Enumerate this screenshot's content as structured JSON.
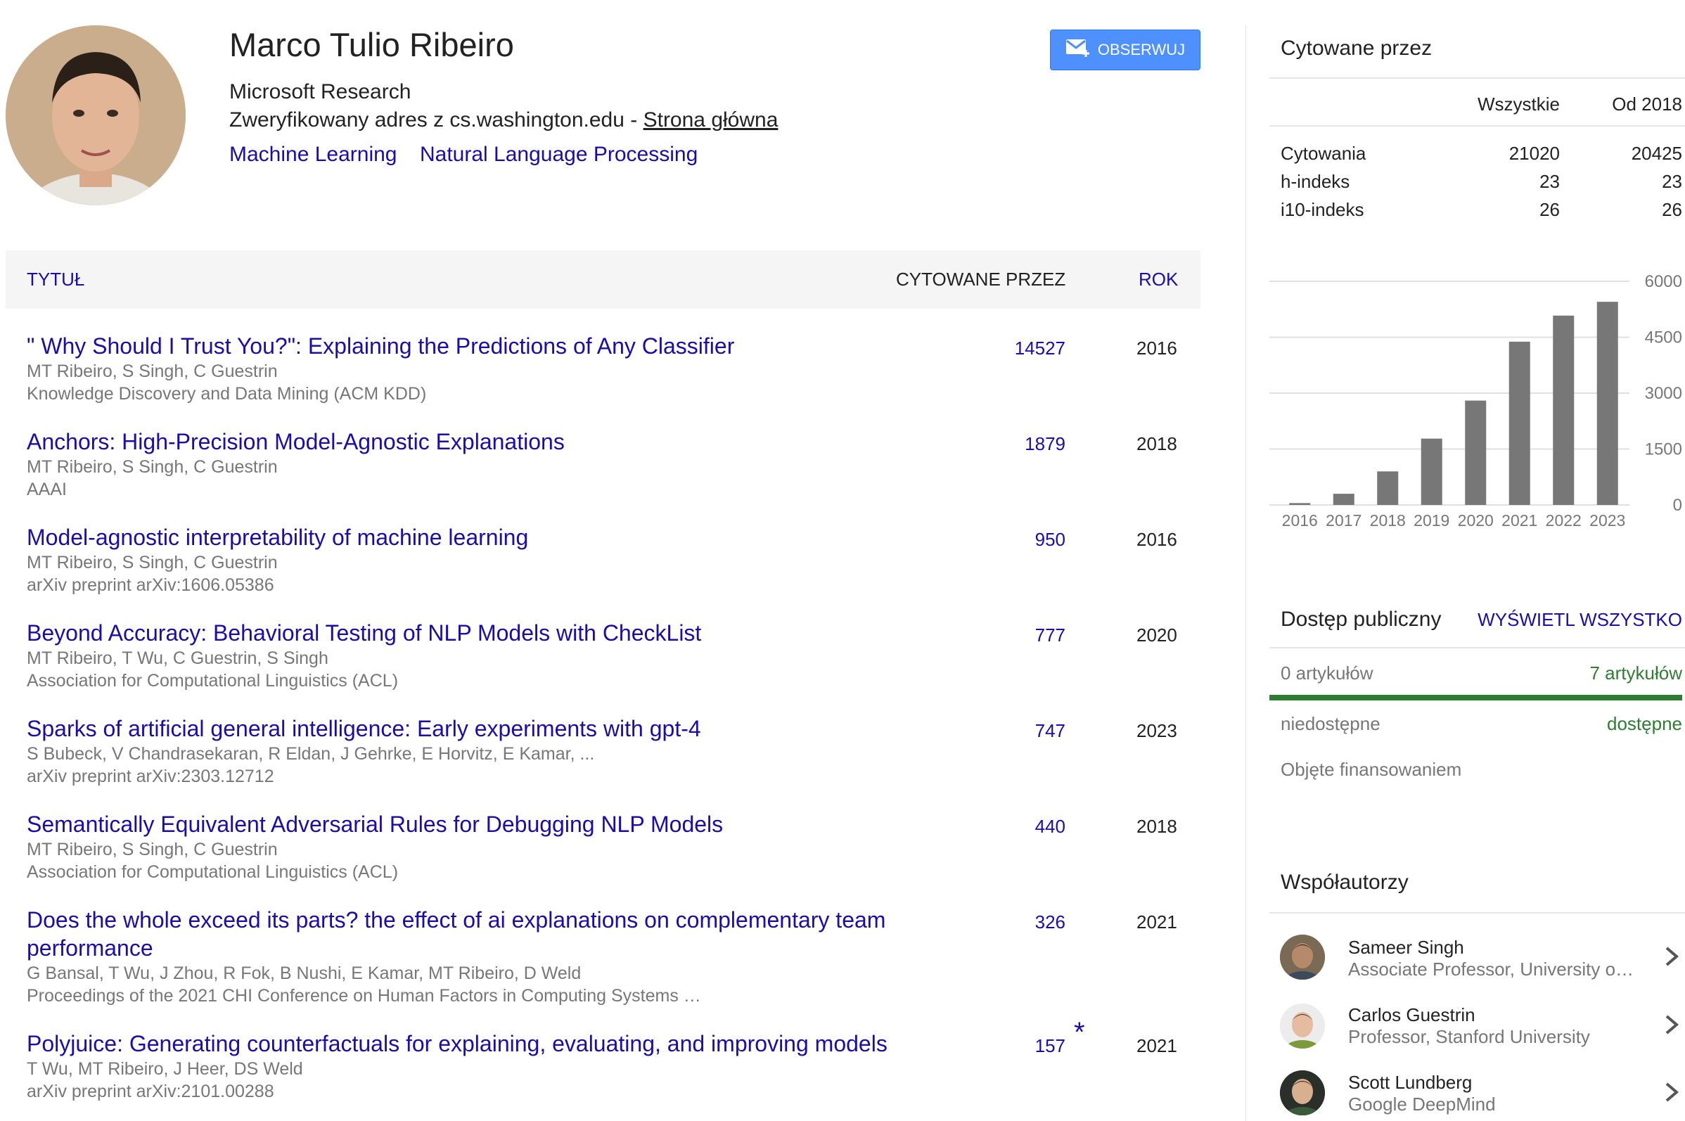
{
  "profile": {
    "name": "Marco Tulio Ribeiro",
    "affiliation": "Microsoft Research",
    "verified_text": "Zweryfikowany adres z cs.washington.edu - ",
    "home_link": "Strona główna",
    "interests": [
      "Machine Learning",
      "Natural Language Processing"
    ],
    "follow_label": "OBSERWUJ"
  },
  "table": {
    "col_title": "TYTUŁ",
    "col_cited": "CYTOWANE PRZEZ",
    "col_year": "ROK",
    "articles": [
      {
        "title": "\" Why Should I Trust You?\": Explaining the Predictions of Any Classifier",
        "authors": "MT Ribeiro, S Singh, C Guestrin",
        "venue": "Knowledge Discovery and Data Mining (ACM KDD)",
        "cites": "14527",
        "year": "2016"
      },
      {
        "title": "Anchors: High-Precision Model-Agnostic Explanations",
        "authors": "MT Ribeiro, S Singh, C Guestrin",
        "venue": "AAAI",
        "cites": "1879",
        "year": "2018"
      },
      {
        "title": "Model-agnostic interpretability of machine learning",
        "authors": "MT Ribeiro, S Singh, C Guestrin",
        "venue": "arXiv preprint arXiv:1606.05386",
        "cites": "950",
        "year": "2016"
      },
      {
        "title": "Beyond Accuracy: Behavioral Testing of NLP Models with CheckList",
        "authors": "MT Ribeiro, T Wu, C Guestrin, S Singh",
        "venue": "Association for Computational Linguistics (ACL)",
        "cites": "777",
        "year": "2020"
      },
      {
        "title": "Sparks of artificial general intelligence: Early experiments with gpt-4",
        "authors": "S Bubeck, V Chandrasekaran, R Eldan, J Gehrke, E Horvitz, E Kamar, ...",
        "venue": "arXiv preprint arXiv:2303.12712",
        "cites": "747",
        "year": "2023"
      },
      {
        "title": "Semantically Equivalent Adversarial Rules for Debugging NLP Models",
        "authors": "MT Ribeiro, S Singh, C Guestrin",
        "venue": "Association for Computational Linguistics (ACL)",
        "cites": "440",
        "year": "2018"
      },
      {
        "title": "Does the whole exceed its parts? the effect of ai explanations on complementary team performance",
        "authors": "G Bansal, T Wu, J Zhou, R Fok, B Nushi, E Kamar, MT Ribeiro, D Weld",
        "venue": "Proceedings of the 2021 CHI Conference on Human Factors in Computing Systems …",
        "cites": "326",
        "year": "2021"
      },
      {
        "title": "Polyjuice: Generating counterfactuals for explaining, evaluating, and improving models",
        "authors": "T Wu, MT Ribeiro, J Heer, DS Weld",
        "venue": "arXiv preprint arXiv:2101.00288",
        "cites": "157",
        "cites_mark": "*",
        "year": "2021"
      }
    ]
  },
  "cited_by": {
    "heading": "Cytowane przez",
    "col_all": "Wszystkie",
    "col_since": "Od 2018",
    "rows": [
      {
        "label": "Cytowania",
        "all": "21020",
        "since": "20425"
      },
      {
        "label": "h-indeks",
        "all": "23",
        "since": "23"
      },
      {
        "label": "i10-indeks",
        "all": "26",
        "since": "26"
      }
    ]
  },
  "chart_data": {
    "type": "bar",
    "categories": [
      "2016",
      "2017",
      "2018",
      "2019",
      "2020",
      "2021",
      "2022",
      "2023"
    ],
    "values": [
      50,
      300,
      900,
      1780,
      2800,
      4380,
      5080,
      5450
    ],
    "ylim": [
      0,
      6000
    ],
    "yticks": [
      "0",
      "1500",
      "3000",
      "4500",
      "6000"
    ],
    "color": "#777777"
  },
  "public_access": {
    "heading": "Dostęp publiczny",
    "view_all": "WYŚWIETL WSZYSTKO",
    "left_count": "0 artykułów",
    "right_count": "7 artykułów",
    "left_label": "niedostępne",
    "right_label": "dostępne",
    "funded": "Objęte finansowaniem",
    "available_fraction": 1.0,
    "bar_color": "#2e7d32"
  },
  "coauthors": {
    "heading": "Współautorzy",
    "items": [
      {
        "name": "Sameer Singh",
        "affiliation": "Associate Professor, University o…"
      },
      {
        "name": "Carlos Guestrin",
        "affiliation": "Professor, Stanford University"
      },
      {
        "name": "Scott Lundberg",
        "affiliation": "Google DeepMind"
      }
    ]
  },
  "colors": {
    "link": "#1a0dab",
    "follow_button": "#4d90fe",
    "bar": "#777777",
    "green": "#2e7d32"
  }
}
